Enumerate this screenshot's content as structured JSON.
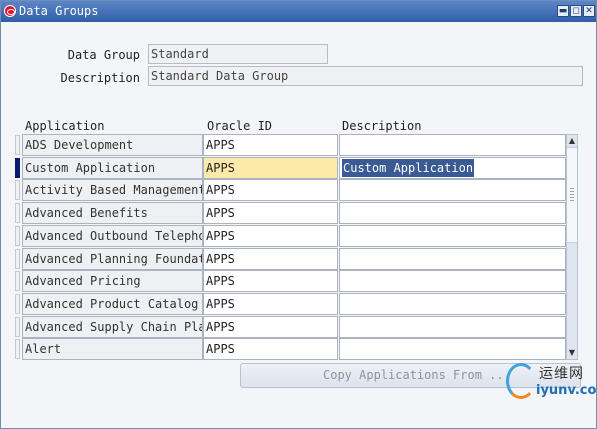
{
  "window": {
    "title": "Data Groups",
    "buttons": {
      "minimize": "▬",
      "maximize": "◻",
      "close": "✕"
    }
  },
  "header": {
    "data_group_label": "Data Group",
    "data_group_value": "Standard",
    "description_label": "Description",
    "description_value": "Standard Data Group"
  },
  "table": {
    "columns": [
      "Application",
      "Oracle ID",
      "Description"
    ],
    "current_row": 1,
    "rows": [
      {
        "application": "ADS Development",
        "oracle_id": "APPS",
        "description": ""
      },
      {
        "application": "Custom Application",
        "oracle_id": "APPS",
        "description": "Custom Application"
      },
      {
        "application": "Activity Based Management",
        "oracle_id": "APPS",
        "description": ""
      },
      {
        "application": "Advanced Benefits",
        "oracle_id": "APPS",
        "description": ""
      },
      {
        "application": "Advanced Outbound Telephon",
        "oracle_id": "APPS",
        "description": ""
      },
      {
        "application": "Advanced Planning Foundati",
        "oracle_id": "APPS",
        "description": ""
      },
      {
        "application": "Advanced Pricing",
        "oracle_id": "APPS",
        "description": ""
      },
      {
        "application": "Advanced Product Catalog",
        "oracle_id": "APPS",
        "description": ""
      },
      {
        "application": "Advanced Supply Chain Plan",
        "oracle_id": "APPS",
        "description": ""
      },
      {
        "application": "Alert",
        "oracle_id": "APPS",
        "description": ""
      }
    ]
  },
  "actions": {
    "copy_label": "Copy Applications From ..."
  },
  "watermark": {
    "cn": "运维网",
    "en": "iyunv.com"
  },
  "colors": {
    "titlebar": "#2f5ea6",
    "current_row_marker": "#0a1a6e",
    "current_cell": "#fde9a9",
    "selection": "#3a5a93"
  }
}
